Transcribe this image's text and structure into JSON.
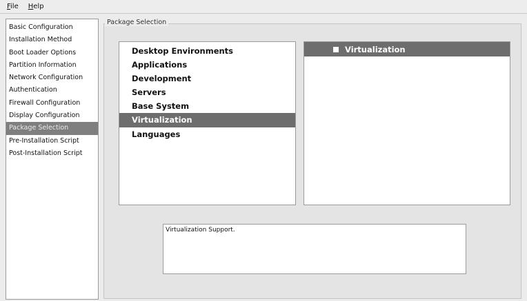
{
  "menubar": {
    "items": [
      "File",
      "Help"
    ]
  },
  "sidebar": {
    "items": [
      "Basic Configuration",
      "Installation Method",
      "Boot Loader Options",
      "Partition Information",
      "Network Configuration",
      "Authentication",
      "Firewall Configuration",
      "Display Configuration",
      "Package Selection",
      "Pre-Installation Script",
      "Post-Installation Script"
    ],
    "selected": "Package Selection"
  },
  "main": {
    "group_title": "Package Selection",
    "package_groups": [
      "Desktop Environments",
      "Applications",
      "Development",
      "Servers",
      "Base System",
      "Virtualization",
      "Languages"
    ],
    "selected_group": "Virtualization",
    "detail_panel": {
      "header_label": "Virtualization",
      "checked": false
    },
    "description": "Virtualization Support."
  },
  "colors": {
    "selection": "#6d6d6d",
    "sidebar_selection": "#7f7f7f"
  }
}
